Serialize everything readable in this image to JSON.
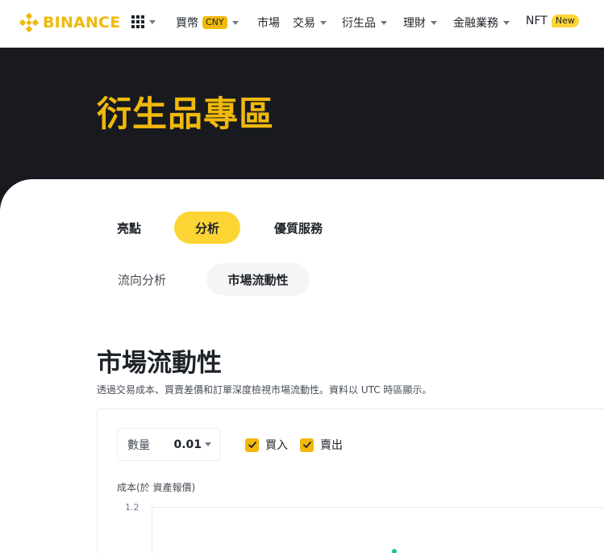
{
  "brand": {
    "name": "BINANCE",
    "color": "#F0B90B"
  },
  "nav": {
    "items": [
      {
        "label": "買幣",
        "badge": "CNY",
        "has_caret": true
      },
      {
        "label": "市場",
        "has_caret": false
      },
      {
        "label": "交易",
        "has_caret": true
      },
      {
        "label": "衍生品",
        "has_caret": true
      },
      {
        "label": "理財",
        "has_caret": true
      },
      {
        "label": "金融業務",
        "has_caret": true
      },
      {
        "label": "NFT",
        "badge": "New",
        "has_caret": false
      }
    ]
  },
  "hero": {
    "title": "衍生品專區"
  },
  "tabs": [
    {
      "label": "亮點",
      "active": false
    },
    {
      "label": "分析",
      "active": true
    },
    {
      "label": "優質服務",
      "active": false
    }
  ],
  "subtabs": [
    {
      "label": "流向分析",
      "active": false
    },
    {
      "label": "市場流動性",
      "active": true
    }
  ],
  "section": {
    "title": "市場流動性",
    "description": "透過交易成本、買賣差價和訂單深度檢視市場流動性。資料以 UTC 時區顯示。"
  },
  "controls": {
    "quantity_label": "數量",
    "quantity_value": "0.01",
    "buy_label": "買入",
    "buy_checked": true,
    "sell_label": "賣出",
    "sell_checked": true
  },
  "chart": {
    "y_axis_title": "成本(於 資產報價)",
    "y_tick_top": "1.2",
    "series_color": "#0ecb81"
  },
  "colors": {
    "accent": "#F0B90B",
    "accent_light": "#FCD535",
    "hero_bg": "#181a20"
  }
}
